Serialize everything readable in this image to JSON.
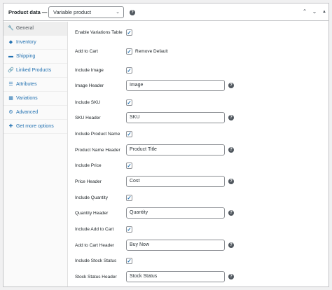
{
  "header": {
    "title": "Product data —",
    "product_type": "Variable product",
    "help": "?",
    "up": "▲",
    "down": "▼",
    "toggle": "▲"
  },
  "sidebar": {
    "items": [
      {
        "icon": "🔧",
        "icon_name": "wrench-icon",
        "label": "General"
      },
      {
        "icon": "◆",
        "icon_name": "inventory-tag-icon",
        "label": "Inventory"
      },
      {
        "icon": "▬",
        "icon_name": "truck-icon",
        "label": "Shipping"
      },
      {
        "icon": "🔗",
        "icon_name": "link-icon",
        "label": "Linked Products"
      },
      {
        "icon": "☰",
        "icon_name": "list-icon",
        "label": "Attributes"
      },
      {
        "icon": "▦",
        "icon_name": "grid-icon",
        "label": "Variations"
      },
      {
        "icon": "⚙",
        "icon_name": "gear-icon",
        "label": "Advanced"
      },
      {
        "icon": "✚",
        "icon_name": "plugin-icon",
        "label": "Get more options"
      }
    ]
  },
  "fields": {
    "enable_variations": {
      "label": "Enable Variations Table",
      "checked": "✓"
    },
    "add_to_cart": {
      "label": "Add to Cart",
      "checked": "✓",
      "text": "Remove Default"
    },
    "include_image": {
      "label": "Include Image",
      "checked": "✓"
    },
    "image_header": {
      "label": "Image Header",
      "value": "Image"
    },
    "include_sku": {
      "label": "Include SKU",
      "checked": "✓"
    },
    "sku_header": {
      "label": "SKU Header",
      "value": "SKU"
    },
    "include_product_name": {
      "label": "Include Product Name",
      "checked": "✓"
    },
    "product_name_header": {
      "label": "Product Name Header",
      "value": "Product Title"
    },
    "include_price": {
      "label": "Include Price",
      "checked": "✓"
    },
    "price_header": {
      "label": "Price Header",
      "value": "Cost"
    },
    "include_quantity": {
      "label": "Include Quantity",
      "checked": "✓"
    },
    "quantity_header": {
      "label": "Quantity Header",
      "value": "Quantity"
    },
    "include_add_to_cart": {
      "label": "Include Add to Cart",
      "checked": "✓"
    },
    "add_to_cart_header": {
      "label": "Add to Cart Header",
      "value": "Buy Now"
    },
    "include_stock_status": {
      "label": "Include Stock Status",
      "checked": "✓"
    },
    "stock_status_header": {
      "label": "Stock Status Header",
      "value": "Stock Status"
    }
  },
  "help_glyph": "?"
}
